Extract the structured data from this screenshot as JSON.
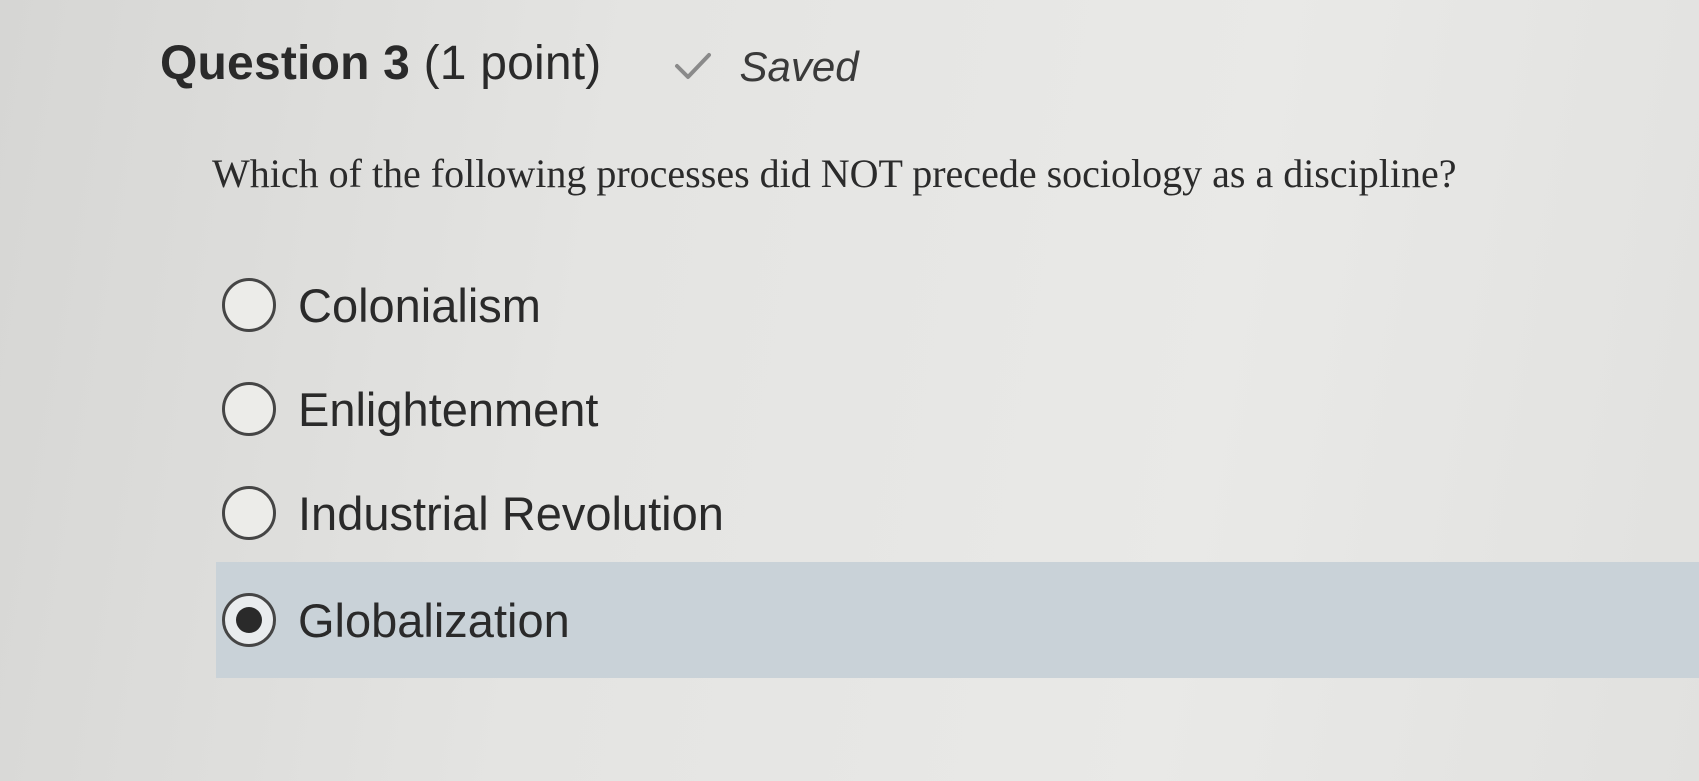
{
  "question": {
    "title": "Question 3",
    "points": "(1 point)",
    "status_icon": "checkmark-icon",
    "status_label": "Saved",
    "prompt": "Which of the following processes did NOT precede sociology as a discipline?"
  },
  "options": [
    {
      "label": "Colonialism",
      "selected": false
    },
    {
      "label": "Enlightenment",
      "selected": false
    },
    {
      "label": "Industrial Revolution",
      "selected": false
    },
    {
      "label": "Globalization",
      "selected": true
    }
  ],
  "colors": {
    "selected_band": "#c9d2d8",
    "text": "#2a2a2a",
    "radio_border": "#454545"
  }
}
